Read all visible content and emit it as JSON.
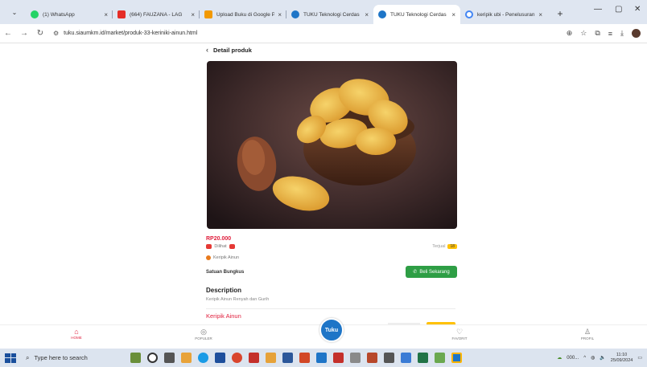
{
  "browser": {
    "tabs": [
      {
        "title": "(1) WhatsApp",
        "color": "#25d366",
        "active": false
      },
      {
        "title": "(664) FAUZANA - LAG",
        "color": "#e52d27",
        "active": false
      },
      {
        "title": "Upload Buku di Google Pl",
        "color": "#f29900",
        "active": false
      },
      {
        "title": "TUKU Teknologi Cerdas",
        "color": "#1e75c7",
        "active": false
      },
      {
        "title": "TUKU Teknologi Cerdas",
        "color": "#1e75c7",
        "active": true
      },
      {
        "title": "keripik ubi - Penelusuran",
        "color": "#4285f4",
        "active": false
      }
    ],
    "url": "tuku.siaumkm.id/market/produk-33-keriniki-ainun.html"
  },
  "page": {
    "header_title": "Detail produk",
    "price": "RP20.000",
    "seen_label": "Dilihat",
    "sold_label": "Terjual",
    "sold_count": "18",
    "store_name": "Keripik Ainun",
    "unit": "Satuan Bungkus",
    "buy_label": "Beli Sekarang",
    "description_title": "Description",
    "description_text": "Keripik Ainun Renyah dan Gurih",
    "related_title": "Keripik Ainun"
  },
  "bottom_nav": {
    "home": "HOME",
    "popular": "POPULER",
    "center": "Tuku",
    "favorite": "FAVORIT",
    "profile": "PROFIL"
  },
  "taskbar": {
    "search_placeholder": "Type here to search",
    "time": "11:10",
    "date": "25/09/2024",
    "tray_text": "000..."
  },
  "colors": {
    "accent": "#e01e3c",
    "buy_button": "#2e9e45",
    "brand_blue": "#1e75c7"
  }
}
